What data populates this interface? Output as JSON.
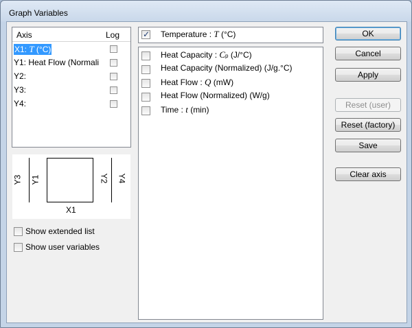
{
  "window": {
    "title": "Graph Variables"
  },
  "axis_list": {
    "header_axis": "Axis",
    "header_log": "Log",
    "rows": [
      {
        "prefix": "X1: ",
        "var": "T",
        "unit": " (°C)",
        "log": false,
        "selected": true
      },
      {
        "prefix": "Y1: Heat Flow (Normali",
        "var": "",
        "unit": "",
        "log": false,
        "selected": false
      },
      {
        "prefix": "Y2:",
        "var": "",
        "unit": "",
        "log": false,
        "selected": false
      },
      {
        "prefix": "Y3:",
        "var": "",
        "unit": "",
        "log": false,
        "selected": false
      },
      {
        "prefix": "Y4:",
        "var": "",
        "unit": "",
        "log": false,
        "selected": false
      }
    ]
  },
  "diagram": {
    "left_outer": "Y3",
    "left_inner": "Y1",
    "right_inner": "Y2",
    "right_outer": "Y4",
    "bottom": "X1"
  },
  "options": {
    "extended_list": {
      "label": "Show extended list",
      "checked": false
    },
    "user_variables": {
      "label": "Show user variables",
      "checked": false
    }
  },
  "x_variable": {
    "label": "Temperature : ",
    "symbol": "T",
    "unit": " (°C)",
    "checked": true
  },
  "variables": [
    {
      "label": "Heat Capacity : ",
      "symbol": "C",
      "sub": "p",
      "unit": " (J/°C)",
      "checked": false
    },
    {
      "label": "Heat Capacity (Normalized)  (J/g.°C)",
      "symbol": "",
      "sub": "",
      "unit": "",
      "checked": false
    },
    {
      "label": "Heat Flow : ",
      "symbol": "Q",
      "sub": "",
      "unit": "  (mW)",
      "checked": false
    },
    {
      "label": "Heat Flow (Normalized)  (W/g)",
      "symbol": "",
      "sub": "",
      "unit": "",
      "checked": false
    },
    {
      "label": "Time : ",
      "symbol": "t",
      "sub": "",
      "unit": "  (min)",
      "checked": false
    }
  ],
  "buttons": {
    "ok": "OK",
    "cancel": "Cancel",
    "apply": "Apply",
    "reset_user": "Reset (user)",
    "reset_factory": "Reset (factory)",
    "save": "Save",
    "clear_axis": "Clear axis"
  }
}
